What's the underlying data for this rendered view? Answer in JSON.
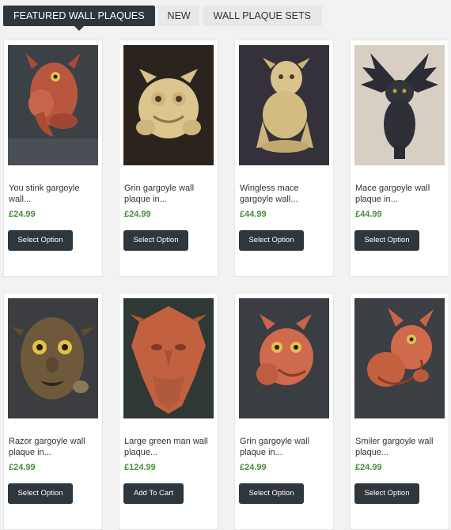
{
  "tabs": [
    {
      "label": "FEATURED WALL PLAQUES",
      "active": true
    },
    {
      "label": "NEW",
      "active": false
    },
    {
      "label": "WALL PLAQUE SETS",
      "active": false
    }
  ],
  "colors": {
    "accent_dark": "#2e363e",
    "price_green": "#4a8e3c",
    "terracotta": "#c8644a",
    "sandstone": "#d9c48c",
    "bronze": "#6e5a3a"
  },
  "products": [
    {
      "name_line1": "You stink gargoyle",
      "name_line2": "wall...",
      "price": "£24.99",
      "button": "Select Option",
      "image_icon": "gargoyle-holding-nose-icon"
    },
    {
      "name_line1": "Grin gargoyle wall",
      "name_line2": "plaque in...",
      "price": "£24.99",
      "button": "Select Option",
      "image_icon": "grin-gargoyle-icon"
    },
    {
      "name_line1": "Wingless mace",
      "name_line2": "gargoyle wall...",
      "price": "£44.99",
      "button": "Select Option",
      "image_icon": "crouching-gargoyle-icon"
    },
    {
      "name_line1": "Mace gargoyle wall",
      "name_line2": "plaque in...",
      "price": "£44.99",
      "button": "Select Option",
      "image_icon": "winged-gargoyle-icon"
    },
    {
      "name_line1": "Razor gargoyle wall",
      "name_line2": "plaque in...",
      "price": "£24.99",
      "button": "Select Option",
      "image_icon": "razor-gargoyle-face-icon"
    },
    {
      "name_line1": "Large green man wall",
      "name_line2": "plaque...",
      "price": "£124.99",
      "button": "Add To Cart",
      "image_icon": "green-man-face-icon"
    },
    {
      "name_line1": "Grin gargoyle wall",
      "name_line2": "plaque in...",
      "price": "£24.99",
      "button": "Select Option",
      "image_icon": "grin-gargoyle-icon"
    },
    {
      "name_line1": "Smiler gargoyle wall",
      "name_line2": "plaque...",
      "price": "£24.99",
      "button": "Select Option",
      "image_icon": "smiler-gargoyle-icon"
    }
  ]
}
